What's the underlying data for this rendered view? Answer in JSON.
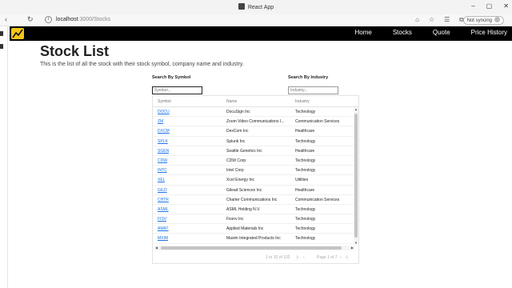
{
  "browser": {
    "tab_title": "React App",
    "url_host": "localhost",
    "url_path": ":3000/Stocks",
    "sync_label": "Not syncing"
  },
  "navbar": {
    "links": [
      "Home",
      "Stocks",
      "Quote",
      "Price History"
    ]
  },
  "page": {
    "title": "Stock List",
    "description": "This is the list of all the stock with their stock symbol, company name and industry."
  },
  "search": {
    "symbol_label": "Search By Symbol",
    "symbol_placeholder": "Symbol...",
    "industry_label": "Search By Industry",
    "industry_placeholder": "Industry..."
  },
  "table": {
    "columns": [
      "Symbol",
      "Name",
      "Industry"
    ],
    "rows": [
      {
        "symbol": "DOCU",
        "name": "DocuSign Inc",
        "industry": "Technology"
      },
      {
        "symbol": "ZM",
        "name": "Zoom Video Communications I...",
        "industry": "Communication Services"
      },
      {
        "symbol": "DXCM",
        "name": "DexCom Inc",
        "industry": "Healthcare"
      },
      {
        "symbol": "SPLK",
        "name": "Splunk Inc",
        "industry": "Technology"
      },
      {
        "symbol": "SGEN",
        "name": "Seattle Genetics Inc",
        "industry": "Healthcare"
      },
      {
        "symbol": "CDW",
        "name": "CDW Corp",
        "industry": "Technology"
      },
      {
        "symbol": "INTC",
        "name": "Intel Corp",
        "industry": "Technology"
      },
      {
        "symbol": "XEL",
        "name": "Xcel Energy Inc",
        "industry": "Utilities"
      },
      {
        "symbol": "GILD",
        "name": "Gilead Sciences Inc",
        "industry": "Healthcare"
      },
      {
        "symbol": "CHTR",
        "name": "Charter Communications Inc",
        "industry": "Communication Services"
      },
      {
        "symbol": "ASML",
        "name": "ASML Holding N.V.",
        "industry": "Technology"
      },
      {
        "symbol": "FISV",
        "name": "Fiserv Inc",
        "industry": "Technology"
      },
      {
        "symbol": "AMAT",
        "name": "Applied Materials Inc",
        "industry": "Technology"
      },
      {
        "symbol": "MXIM",
        "name": "Maxim Integrated Products Inc",
        "industry": "Technology"
      }
    ],
    "pager_count": "1 to 15 of 102",
    "pager_page": "Page 1 of 7"
  }
}
